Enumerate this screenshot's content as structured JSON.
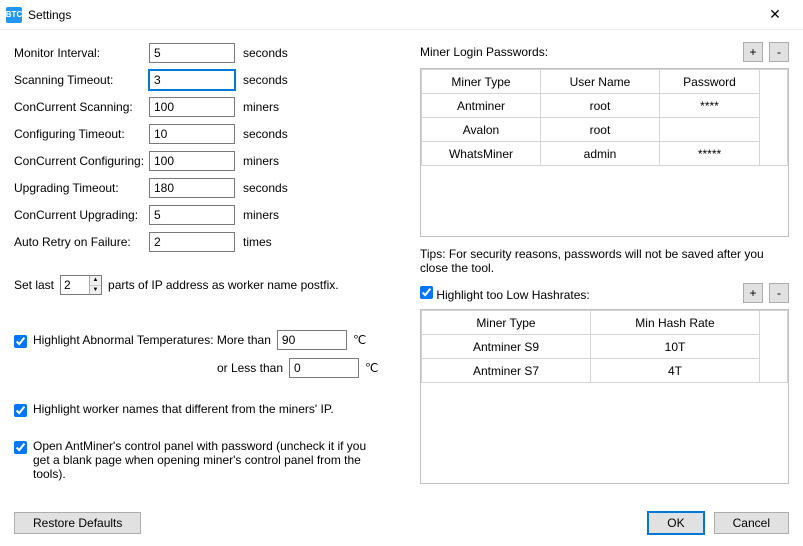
{
  "window": {
    "title": "Settings",
    "icon_text": "BTC"
  },
  "left": {
    "monitor_interval": {
      "label": "Monitor Interval:",
      "value": "5",
      "unit": "seconds"
    },
    "scanning_timeout": {
      "label": "Scanning Timeout:",
      "value": "3",
      "unit": "seconds"
    },
    "concurrent_scanning": {
      "label": "ConCurrent Scanning:",
      "value": "100",
      "unit": "miners"
    },
    "configuring_timeout": {
      "label": "Configuring Timeout:",
      "value": "10",
      "unit": "seconds"
    },
    "concurrent_configuring": {
      "label": "ConCurrent Configuring:",
      "value": "100",
      "unit": "miners"
    },
    "upgrading_timeout": {
      "label": "Upgrading Timeout:",
      "value": "180",
      "unit": "seconds"
    },
    "concurrent_upgrading": {
      "label": "ConCurrent Upgrading:",
      "value": "5",
      "unit": "miners"
    },
    "auto_retry": {
      "label": "Auto Retry on Failure:",
      "value": "2",
      "unit": "times"
    },
    "setlast_pre": "Set last",
    "setlast_value": "2",
    "setlast_post": "parts of IP address as worker name postfix.",
    "hl_temp_label": "Highlight Abnormal Temperatures: More than",
    "hl_temp_high": "90",
    "hl_temp_or": "or Less than",
    "hl_temp_low": "0",
    "deg_unit": "℃",
    "hl_worker_label": "Highlight worker names that different from the miners' IP.",
    "cp_pw_label": "Open AntMiner's control panel with password (uncheck it if you get a blank page when opening miner's control panel from the tools).",
    "restore_label": "Restore Defaults"
  },
  "right": {
    "login_header": "Miner Login Passwords:",
    "login_cols": {
      "type": "Miner Type",
      "user": "User Name",
      "pw": "Password"
    },
    "logins": [
      {
        "type": "Antminer",
        "user": "root",
        "pw": "****"
      },
      {
        "type": "Avalon",
        "user": "root",
        "pw": ""
      },
      {
        "type": "WhatsMiner",
        "user": "admin",
        "pw": "*****"
      }
    ],
    "tip": "Tips: For security reasons, passwords will not be saved after you close the tool.",
    "hl_hash_label": "Highlight too Low Hashrates:",
    "hash_cols": {
      "type": "Miner Type",
      "rate": "Min Hash Rate"
    },
    "hashes": [
      {
        "type": "Antminer S9",
        "rate": "10T"
      },
      {
        "type": "Antminer S7",
        "rate": "4T"
      }
    ]
  },
  "buttons": {
    "ok": "OK",
    "cancel": "Cancel",
    "plus": "+",
    "minus": "-"
  },
  "chart_data": {
    "type": "table",
    "tables": [
      {
        "title": "Miner Login Passwords",
        "columns": [
          "Miner Type",
          "User Name",
          "Password"
        ],
        "rows": [
          [
            "Antminer",
            "root",
            "****"
          ],
          [
            "Avalon",
            "root",
            ""
          ],
          [
            "WhatsMiner",
            "admin",
            "*****"
          ]
        ]
      },
      {
        "title": "Highlight too Low Hashrates",
        "columns": [
          "Miner Type",
          "Min Hash Rate"
        ],
        "rows": [
          [
            "Antminer S9",
            "10T"
          ],
          [
            "Antminer S7",
            "4T"
          ]
        ]
      }
    ]
  }
}
